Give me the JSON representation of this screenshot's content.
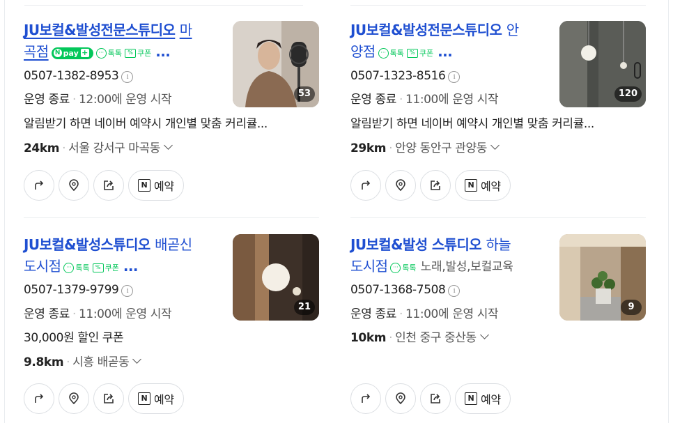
{
  "results": [
    {
      "name": "JU보컬&발성전문스튜디오",
      "suffix_line1": "마",
      "suffix_line2": "곡점",
      "badges": {
        "npay": "pay",
        "talk": "톡톡",
        "coupon": "쿠폰",
        "more": "..."
      },
      "phone": "0507-1382-8953",
      "status": "운영 종료",
      "hours": "12:00에 운영 시작",
      "desc": "알림받기 하면 네이버 예약시 개인별 맞춤 커리큘...",
      "distance": "24km",
      "address": "서울 강서구 마곡동",
      "photo_count": "53",
      "reserve_label": "예약"
    },
    {
      "name": "JU보컬&발성전문스튜디오",
      "suffix_line1": "안",
      "suffix_line2": "양점",
      "badges": {
        "talk": "톡톡",
        "coupon": "쿠폰",
        "more": "..."
      },
      "phone": "0507-1323-8516",
      "status": "운영 종료",
      "hours": "11:00에 운영 시작",
      "desc": "알림받기 하면 네이버 예약시 개인별 맞춤 커리큘...",
      "distance": "29km",
      "address": "안양 동안구 관양동",
      "photo_count": "120",
      "reserve_label": "예약"
    },
    {
      "name": "JU보컬&발성스튜디오",
      "suffix_line1": "배곧신",
      "suffix_line2": "도시점",
      "badges": {
        "talk": "톡톡",
        "coupon": "쿠폰",
        "more": "..."
      },
      "phone": "0507-1379-9799",
      "status": "운영 종료",
      "hours": "11:00에 운영 시작",
      "desc": "30,000원 할인 쿠폰",
      "distance": "9.8km",
      "address": "시흥 배곧동",
      "photo_count": "21",
      "reserve_label": "예약"
    },
    {
      "name": "JU보컬&발성 스튜디오",
      "suffix_line1": "하늘",
      "suffix_line2": "도시점",
      "badges": {
        "talk": "톡톡",
        "tags": "노래,발성,보컬교육"
      },
      "phone": "0507-1368-7508",
      "status": "운영 종료",
      "hours": "11:00에 운영 시작",
      "distance": "10km",
      "address": "인천 중구 중산동",
      "photo_count": "9",
      "reserve_label": "예약"
    }
  ],
  "icons": {
    "directions": "turn-right-arrow-icon",
    "location": "map-pin-icon",
    "share": "share-icon",
    "reserve": "naver-booking-icon",
    "info": "info-circle-icon",
    "expand": "chevron-down-icon"
  },
  "colors": {
    "title": "#1f4fd1",
    "green": "#03c75a"
  }
}
